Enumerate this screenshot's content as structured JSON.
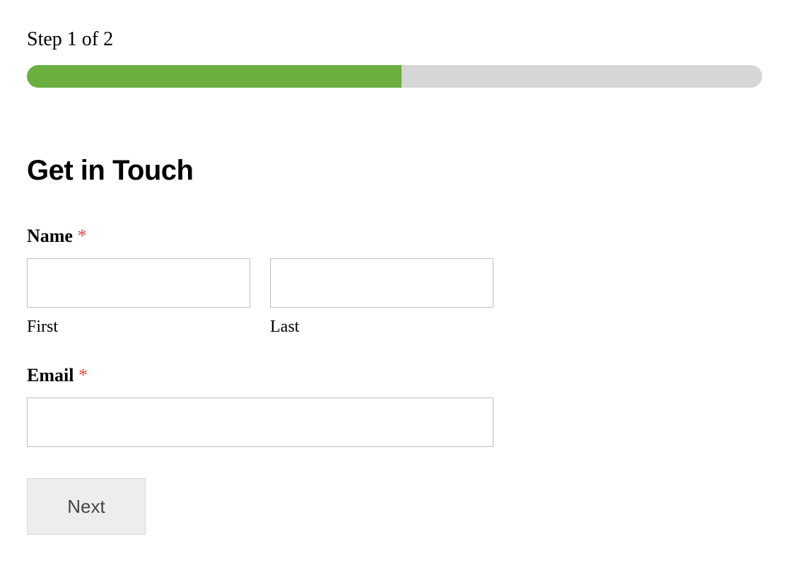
{
  "step": {
    "indicator": "Step 1 of 2",
    "progress_percent": 51
  },
  "form": {
    "title": "Get in Touch",
    "name": {
      "label": "Name",
      "required_marker": "*",
      "first": {
        "sublabel": "First",
        "value": ""
      },
      "last": {
        "sublabel": "Last",
        "value": ""
      }
    },
    "email": {
      "label": "Email",
      "required_marker": "*",
      "value": ""
    },
    "next_button": "Next"
  },
  "colors": {
    "progress_fill": "#6bb03f",
    "progress_track": "#d6d6d6",
    "required": "#e74c3c"
  }
}
